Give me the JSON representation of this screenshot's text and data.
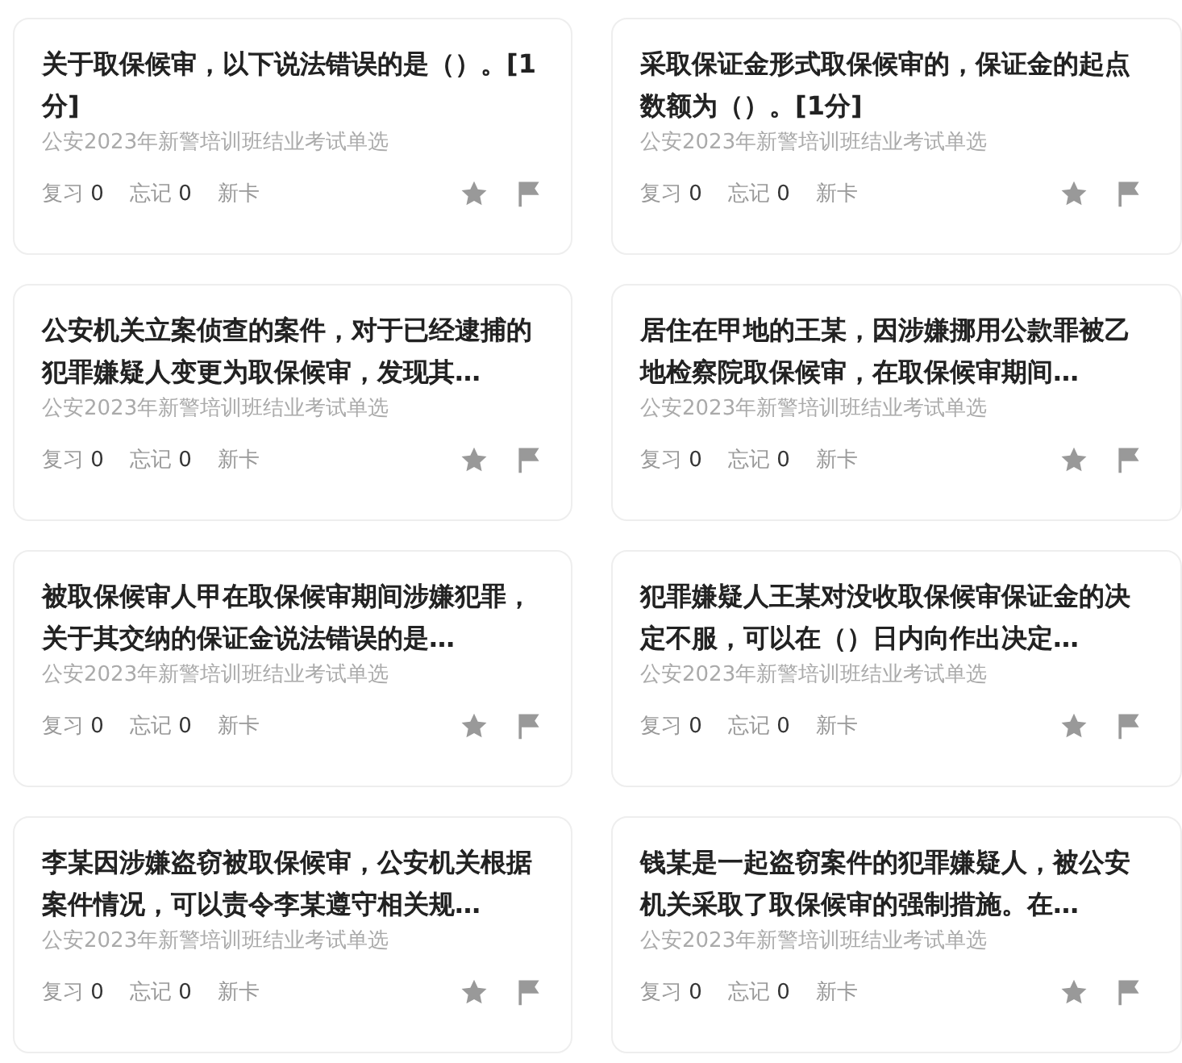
{
  "cards": [
    {
      "title": "关于取保候审，以下说法错误的是（）。[1分]",
      "source": "公安2023年新警培训班结业考试单选",
      "stats": [
        {
          "label": "复习",
          "count": "0"
        },
        {
          "label": "忘记",
          "count": "0"
        }
      ],
      "tag": "新卡"
    },
    {
      "title": "采取保证金形式取保候审的，保证金的起点数额为（）。[1分]",
      "source": "公安2023年新警培训班结业考试单选",
      "stats": [
        {
          "label": "复习",
          "count": "0"
        },
        {
          "label": "忘记",
          "count": "0"
        }
      ],
      "tag": "新卡"
    },
    {
      "title": "公安机关立案侦查的案件，对于已经逮捕的犯罪嫌疑人变更为取保候审，发现其…",
      "source": "公安2023年新警培训班结业考试单选",
      "stats": [
        {
          "label": "复习",
          "count": "0"
        },
        {
          "label": "忘记",
          "count": "0"
        }
      ],
      "tag": "新卡"
    },
    {
      "title": "居住在甲地的王某，因涉嫌挪用公款罪被乙地检察院取保候审，在取保候审期间…",
      "source": "公安2023年新警培训班结业考试单选",
      "stats": [
        {
          "label": "复习",
          "count": "0"
        },
        {
          "label": "忘记",
          "count": "0"
        }
      ],
      "tag": "新卡"
    },
    {
      "title": "被取保候审人甲在取保候审期间涉嫌犯罪，关于其交纳的保证金说法错误的是…",
      "source": "公安2023年新警培训班结业考试单选",
      "stats": [
        {
          "label": "复习",
          "count": "0"
        },
        {
          "label": "忘记",
          "count": "0"
        }
      ],
      "tag": "新卡"
    },
    {
      "title": "犯罪嫌疑人王某对没收取保候审保证金的决定不服，可以在（）日内向作出决定…",
      "source": "公安2023年新警培训班结业考试单选",
      "stats": [
        {
          "label": "复习",
          "count": "0"
        },
        {
          "label": "忘记",
          "count": "0"
        }
      ],
      "tag": "新卡"
    },
    {
      "title": "李某因涉嫌盗窃被取保候审，公安机关根据案件情况，可以责令李某遵守相关规…",
      "source": "公安2023年新警培训班结业考试单选",
      "stats": [
        {
          "label": "复习",
          "count": "0"
        },
        {
          "label": "忘记",
          "count": "0"
        }
      ],
      "tag": "新卡"
    },
    {
      "title": "钱某是一起盗窃案件的犯罪嫌疑人，被公安机关采取了取保候审的强制措施。在…",
      "source": "公安2023年新警培训班结业考试单选",
      "stats": [
        {
          "label": "复习",
          "count": "0"
        },
        {
          "label": "忘记",
          "count": "0"
        }
      ],
      "tag": "新卡"
    }
  ]
}
